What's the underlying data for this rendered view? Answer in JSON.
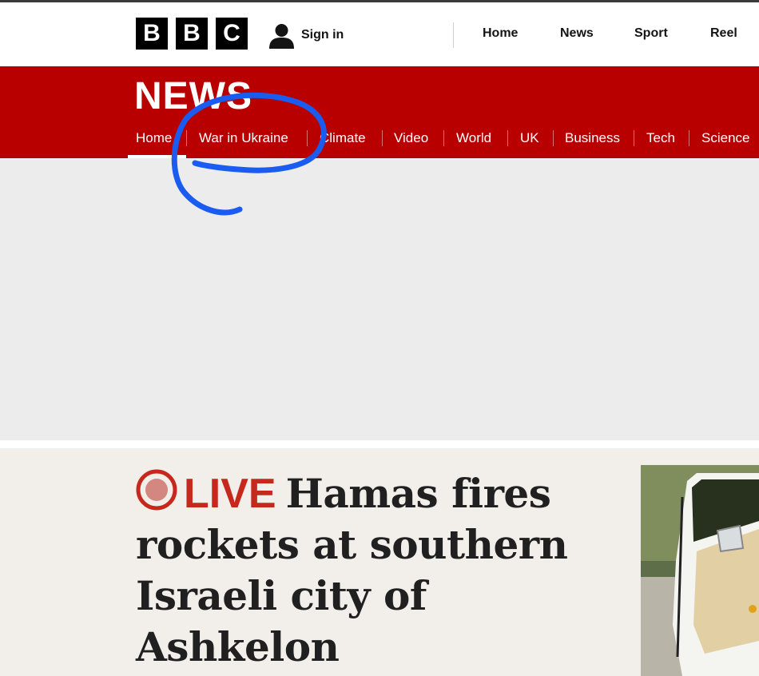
{
  "bbc_logo": {
    "letters": [
      "B",
      "B",
      "C"
    ]
  },
  "account": {
    "signin_label": "Sign in",
    "icon": "user-icon"
  },
  "global_nav": {
    "items": [
      {
        "label": "Home"
      },
      {
        "label": "News"
      },
      {
        "label": "Sport"
      },
      {
        "label": "Reel"
      }
    ]
  },
  "news_header": {
    "wordmark": "NEWS",
    "nav_items": [
      {
        "label": "Home",
        "active": true
      },
      {
        "label": "War in Ukraine"
      },
      {
        "label": "Climate"
      },
      {
        "label": "Video"
      },
      {
        "label": "World"
      },
      {
        "label": "UK"
      },
      {
        "label": "Business"
      },
      {
        "label": "Tech"
      },
      {
        "label": "Science"
      }
    ]
  },
  "top_story": {
    "live_label": "LIVE",
    "headline": "Hamas fires rockets at southern Israeli city of Ashkelon"
  },
  "colors": {
    "brand_red": "#b80000",
    "live_red": "#c6281d",
    "annotation_blue": "#1a5cf0"
  }
}
